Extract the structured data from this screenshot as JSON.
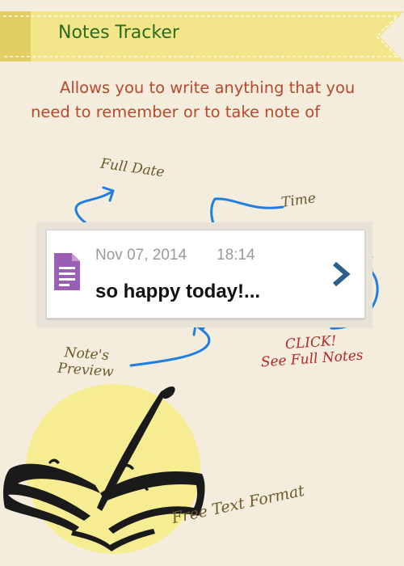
{
  "header": {
    "title": "Notes Tracker"
  },
  "intro": {
    "line1": "Allows you to write anything that you",
    "line2": "need to remember or to take note of"
  },
  "note_card": {
    "date": "Nov 07, 2014",
    "time": "18:14",
    "preview": "so happy today!..."
  },
  "annotations": {
    "full_date": "Full Date",
    "time": "Time",
    "preview_line1": "Note's",
    "preview_line2": "Preview",
    "click_line1": "CLICK!",
    "click_line2": "See Full Notes",
    "free_text": "Free Text Format"
  },
  "icons": {
    "document": "document-icon",
    "chevron": "chevron-right-icon",
    "illustration": "quill-book-icon"
  },
  "colors": {
    "background": "#f4ecdc",
    "ribbon": "#f3e58a",
    "title_green": "#2e6b1f",
    "intro_text": "#b54a2c",
    "arrow_blue": "#1f7fe0",
    "doc_purple": "#9a5fb5",
    "chevron_blue": "#2d5f8c",
    "click_red": "#b22a2a"
  }
}
